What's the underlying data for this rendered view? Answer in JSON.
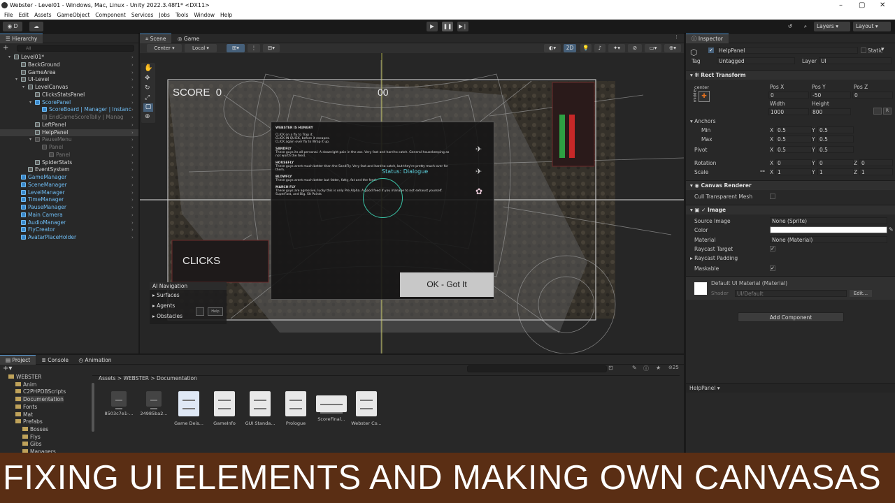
{
  "window": {
    "title": "Webster - Level01 - Windows, Mac, Linux - Unity 2022.3.48f1* <DX11>"
  },
  "menu": [
    "File",
    "Edit",
    "Assets",
    "GameObject",
    "Component",
    "Services",
    "Jobs",
    "Tools",
    "Window",
    "Help"
  ],
  "toolbar": {
    "account": "D",
    "layers": "Layers",
    "layout": "Layout"
  },
  "hierarchy": {
    "tab": "Hierarchy",
    "search_placeholder": "All",
    "items": [
      {
        "label": "Level01*",
        "depth": 0,
        "style": "normal"
      },
      {
        "label": "BackGround",
        "depth": 1,
        "style": "normal"
      },
      {
        "label": "GameArea",
        "depth": 1,
        "style": "normal"
      },
      {
        "label": "UI-Level",
        "depth": 1,
        "style": "normal"
      },
      {
        "label": "LevelCanvas",
        "depth": 2,
        "style": "normal"
      },
      {
        "label": "ClicksStatsPanel",
        "depth": 3,
        "style": "normal"
      },
      {
        "label": "ScorePanel",
        "depth": 3,
        "style": "cyan"
      },
      {
        "label": "ScoreBoard | Manager | Instanc",
        "depth": 4,
        "style": "cyan"
      },
      {
        "label": "EndGameScoreTally | Manag",
        "depth": 4,
        "style": "dim"
      },
      {
        "label": "LeftPanel",
        "depth": 3,
        "style": "normal"
      },
      {
        "label": "HelpPanel",
        "depth": 3,
        "style": "sel"
      },
      {
        "label": "PauseMenu",
        "depth": 3,
        "style": "dim"
      },
      {
        "label": "Panel",
        "depth": 4,
        "style": "dim"
      },
      {
        "label": "Panel",
        "depth": 5,
        "style": "dim"
      },
      {
        "label": "SpiderStats",
        "depth": 3,
        "style": "normal"
      },
      {
        "label": "EventSystem",
        "depth": 2,
        "style": "normal"
      },
      {
        "label": "GameManager",
        "depth": 1,
        "style": "cyan"
      },
      {
        "label": "SceneManager",
        "depth": 1,
        "style": "cyan"
      },
      {
        "label": "LevelManager",
        "depth": 1,
        "style": "cyan"
      },
      {
        "label": "TimeManager",
        "depth": 1,
        "style": "cyan"
      },
      {
        "label": "PauseManager",
        "depth": 1,
        "style": "cyan"
      },
      {
        "label": "Main Camera",
        "depth": 1,
        "style": "cyan"
      },
      {
        "label": "AudioManager",
        "depth": 1,
        "style": "cyan"
      },
      {
        "label": "FlyCreator",
        "depth": 1,
        "style": "cyan"
      },
      {
        "label": "AvatarPlaceHolder",
        "depth": 1,
        "style": "cyan"
      }
    ]
  },
  "scene": {
    "tabs": [
      "Scene",
      "Game"
    ],
    "pivot": "Center",
    "space": "Local",
    "mode2d": "2D",
    "hud": {
      "score_label": "SCORE",
      "score_value": "0",
      "timer": "00",
      "clicks": "CLICKS"
    },
    "help": {
      "title": "WEBSTER IS HUNGRY",
      "lines": [
        "CLICK on a fly to Trap it.",
        "CLICK IN QUICK, before it escapes.",
        "CLICK again over fly to Wrap it up."
      ],
      "sections": [
        {
          "head": "SANDFLY",
          "text": "These guys its all personal. A downright pain in the ass. Very fast and hard to catch. General housekeeping as not worth the feed."
        },
        {
          "head": "HOUSEFLY",
          "text": "These guys arent much better than the SandFly. Very fast and hard to catch, but they're pretty much over for them."
        },
        {
          "head": "BLOWFLY",
          "text": "These guys arent much better but fatter, fatty, fat and the feed."
        },
        {
          "head": "MARCH FLY",
          "text": "These guys are agressive, lucky this is only Pre Alpha. A good feed if you manage to not exhaust yourself. SuperFast, and Big. Slt Points"
        }
      ],
      "status": "Status: Dialogue",
      "ok_button": "OK - Got It"
    },
    "ai_nav": {
      "title": "AI Navigation",
      "items": [
        "Surfaces",
        "Agents",
        "Obstacles"
      ]
    },
    "mini_buttons": [
      "",
      ""
    ],
    "help_mini": "Help"
  },
  "inspector": {
    "tab": "Inspector",
    "object_name": "HelpPanel",
    "static_label": "Static",
    "tag_label": "Tag",
    "tag": "Untagged",
    "layer_label": "Layer",
    "layer": "UI",
    "rect": {
      "title": "Rect Transform",
      "anchor_preset_x": "center",
      "anchor_preset_y": "middle",
      "pos_x_label": "Pos X",
      "pos_y_label": "Pos Y",
      "pos_z_label": "Pos Z",
      "pos_x": "0",
      "pos_y": "-50",
      "pos_z": "0",
      "width_label": "Width",
      "height_label": "Height",
      "width": "1000",
      "height": "800",
      "anchors_label": "Anchors",
      "min_label": "Min",
      "min_x": "0.5",
      "min_y": "0.5",
      "max_label": "Max",
      "max_x": "0.5",
      "max_y": "0.5",
      "pivot_label": "Pivot",
      "pivot_x": "0.5",
      "pivot_y": "0.5",
      "rotation_label": "Rotation",
      "rot_x": "0",
      "rot_y": "0",
      "rot_z": "0",
      "scale_label": "Scale",
      "scale_x": "1",
      "scale_y": "1",
      "scale_z": "1",
      "x": "X",
      "y": "Y",
      "z": "Z"
    },
    "canvas_renderer": {
      "title": "Canvas Renderer",
      "cull_label": "Cull Transparent Mesh"
    },
    "image": {
      "title": "Image",
      "source_label": "Source Image",
      "source": "None (Sprite)",
      "color_label": "Color",
      "material_label": "Material",
      "material": "None (Material)",
      "raycast_label": "Raycast Target",
      "padding_label": "Raycast Padding",
      "maskable_label": "Maskable"
    },
    "default_material": "Default UI Material (Material)",
    "shader_label": "Shader",
    "shader": "UI/Default",
    "edit_button": "Edit...",
    "add_component": "Add Component",
    "footer": "HelpPanel"
  },
  "project": {
    "tabs": [
      "Project",
      "Console",
      "Animation"
    ],
    "breadcrumb": [
      "Assets",
      "WEBSTER",
      "Documentation"
    ],
    "tree": [
      "WEBSTER",
      "Anim",
      "C2PHPDBScripts",
      "Documentation",
      "Fonts",
      "Mat",
      "Prefabs",
      "Bosses",
      "Flys",
      "Gibs",
      "Managers"
    ],
    "assets": [
      "8503c7e1-...",
      "24985ba2...",
      "Game Deis...",
      "GameInfo",
      "GUI Standa...",
      "Prologue",
      "ScoreFinal...",
      "Webster Co..."
    ],
    "count": "25"
  },
  "banner": "FIXING UI ELEMENTS AND MAKING OWN CANVASAS",
  "colors": {
    "accent": "#3a86c8",
    "cyan_text": "#6fbef6",
    "banner_bg": "#5a2e14",
    "status_green": "#2ea043",
    "status_red": "#c62828"
  }
}
